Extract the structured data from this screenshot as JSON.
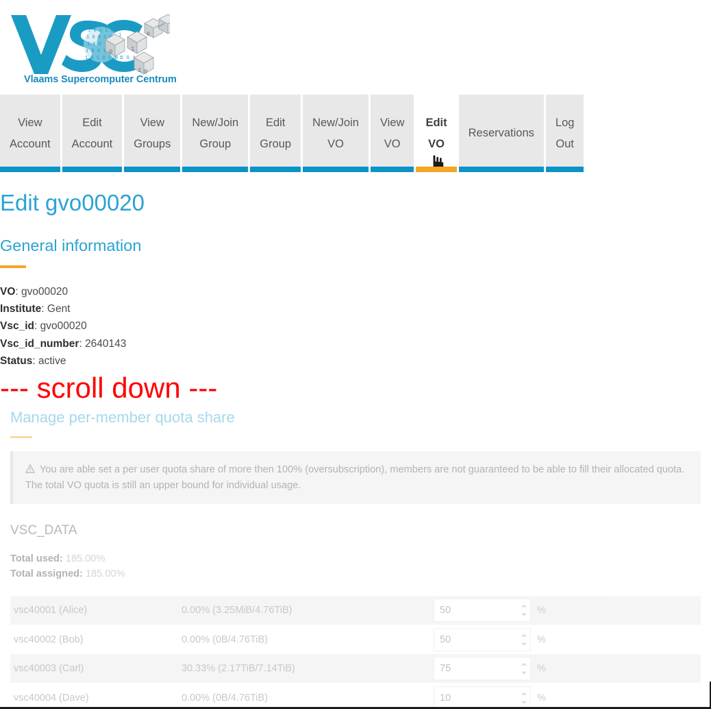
{
  "brand": {
    "logo_text": "VSC",
    "caption": "Vlaams Supercomputer Centrum",
    "logo_color": "#1a9bc4",
    "caption_color": "#1a8bbd"
  },
  "nav": {
    "active_index": 7,
    "underline_color": "#0b93c8",
    "active_underline_color": "#f5a623",
    "cursor_icon": "pointing-hand-cursor-icon",
    "tabs": [
      {
        "line1": "View",
        "line2": "Account"
      },
      {
        "line1": "Edit",
        "line2": "Account"
      },
      {
        "line1": "View",
        "line2": "Groups"
      },
      {
        "line1": "New/Join",
        "line2": "Group"
      },
      {
        "line1": "Edit",
        "line2": "Group"
      },
      {
        "line1": "New/Join",
        "line2": "VO"
      },
      {
        "line1": "View",
        "line2": "VO"
      },
      {
        "line1": "Edit",
        "line2": "VO"
      },
      {
        "line1": "Reservations",
        "line2": ""
      },
      {
        "line1": "Log",
        "line2": "Out"
      }
    ]
  },
  "page": {
    "title": "Edit gvo00020",
    "section_general": "General information",
    "info": [
      {
        "label": "VO",
        "value": "gvo00020"
      },
      {
        "label": "Institute",
        "value": "Gent"
      },
      {
        "label": "Vsc_id",
        "value": "gvo00020"
      },
      {
        "label": "Vsc_id_number",
        "value": "2640143"
      },
      {
        "label": "Status",
        "value": "active"
      }
    ],
    "scroll_hint": "--- scroll down ---",
    "scroll_hint_color": "#ff0000"
  },
  "quota": {
    "section_title": "Manage per-member quota share",
    "warning_icon": "warning-triangle-icon",
    "warning_text": "You are able set a per user quota share of more then 100% (oversubscription), members are not guaranteed to be able to fill their allocated quota. The total VO quota is still an upper bound for individual usage.",
    "dataset": "VSC_DATA",
    "total_used_label": "Total used:",
    "total_used_value": "185.00%",
    "total_assigned_label": "Total assigned:",
    "total_assigned_value": "185.00%",
    "percent_suffix": "%",
    "rows": [
      {
        "member": "vsc40001 (Alice)",
        "usage": "0.00% (3.25MiB/4.76TiB)",
        "share": "50"
      },
      {
        "member": "vsc40002 (Bob)",
        "usage": "0.00% (0B/4.76TiB)",
        "share": "50"
      },
      {
        "member": "vsc40003 (Carl)",
        "usage": "30.33% (2.17TiB/7.14TiB)",
        "share": "75"
      },
      {
        "member": "vsc40004 (Dave)",
        "usage": "0.00% (0B/4.76TiB)",
        "share": "10"
      }
    ]
  }
}
